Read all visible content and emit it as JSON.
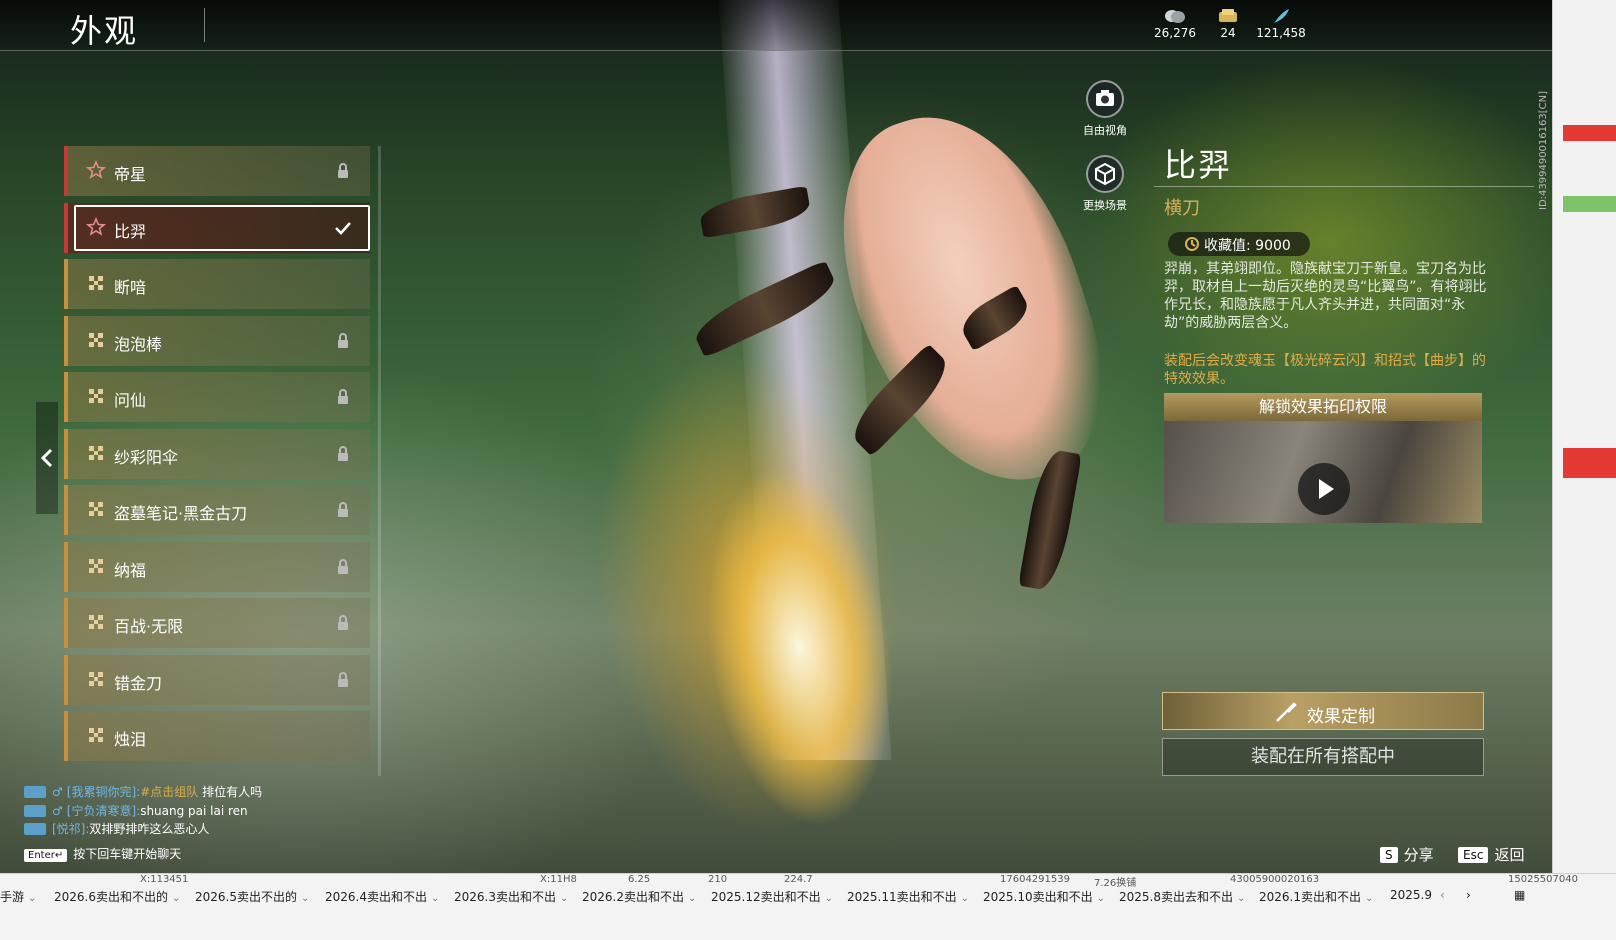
{
  "header": {
    "title": "外观"
  },
  "currencies": [
    {
      "icon": "coin-stack-icon",
      "value": "26,276"
    },
    {
      "icon": "ticket-icon",
      "value": "24"
    },
    {
      "icon": "feather-icon",
      "value": "121,458"
    }
  ],
  "skins": [
    {
      "name": "帝星",
      "icon": "star-icon",
      "state": "locked",
      "tier": "red"
    },
    {
      "name": "比羿",
      "icon": "star-icon",
      "state": "equipped",
      "tier": "red"
    },
    {
      "name": "断喑",
      "icon": "pattern-icon",
      "state": "owned",
      "tier": "gold"
    },
    {
      "name": "泡泡棒",
      "icon": "pattern-icon",
      "state": "locked",
      "tier": "gold"
    },
    {
      "name": "问仙",
      "icon": "pattern-icon",
      "state": "locked",
      "tier": "gold"
    },
    {
      "name": "纱彩阳伞",
      "icon": "pattern-icon",
      "state": "locked",
      "tier": "gold"
    },
    {
      "name": "盗墓笔记·黑金古刀",
      "icon": "pattern-icon",
      "state": "locked",
      "tier": "gold"
    },
    {
      "name": "纳福",
      "icon": "pattern-icon",
      "state": "locked",
      "tier": "gold"
    },
    {
      "name": "百战·无限",
      "icon": "pattern-icon",
      "state": "locked",
      "tier": "gold"
    },
    {
      "name": "错金刀",
      "icon": "pattern-icon",
      "state": "locked",
      "tier": "gold"
    },
    {
      "name": "烛泪",
      "icon": "pattern-icon",
      "state": "owned",
      "tier": "gold"
    }
  ],
  "tools": {
    "free_view": "自由视角",
    "change_scene": "更换场景"
  },
  "detail": {
    "name": "比羿",
    "type": "横刀",
    "collect_label": "收藏值: 9000",
    "description": "羿崩，其弟翊即位。隐族献宝刀于新皇。宝刀名为比羿，取材自上一劫后灭绝的灵鸟“比翼鸟”。有将翊比作兄长，和隐族愿于凡人齐头并进，共同面对“永劫”的威胁两层含义。",
    "effect_note": "装配后会改变魂玉【极光碎云闪】和招式【曲步】的特效效果。",
    "unlock_title": "解锁效果拓印权限",
    "customize_button": "效果定制",
    "equip_button": "装配在所有搭配中"
  },
  "chat": [
    {
      "name": "[我累铜你完]:",
      "link": "#点击组队",
      "text": " 排位有人吗"
    },
    {
      "name": "[宁负清寒意]:",
      "link": "",
      "text": "shuang pai  lai ren"
    },
    {
      "name": "[悦祁]:",
      "link": "",
      "text": "双排野排咋这么恶心人"
    }
  ],
  "chat_hint": {
    "key": "Enter↵",
    "text": "按下回车键开始聊天"
  },
  "hotkeys": [
    {
      "key": "S",
      "label": "分享"
    },
    {
      "key": "Esc",
      "label": "返回"
    }
  ],
  "side_id": "ID:4399490016163[CN]",
  "taskbar": {
    "faint": [
      "X:113451",
      "X:11H8",
      "6.25",
      "210",
      "224.7",
      "17604291539",
      "7.26换铺",
      "43005900020163",
      "15025507040"
    ],
    "tabs": [
      "手游",
      "2026.6卖出和不出的",
      "2026.5卖出不出的",
      "2026.4卖出和不出",
      "2026.3卖出和不出",
      "2026.2卖出和不出",
      "2025.12卖出和不出",
      "2025.11卖出和不出",
      "2025.10卖出和不出",
      "2025.8卖出去和不出",
      "2026.1卖出和不出",
      "2025.9"
    ]
  }
}
